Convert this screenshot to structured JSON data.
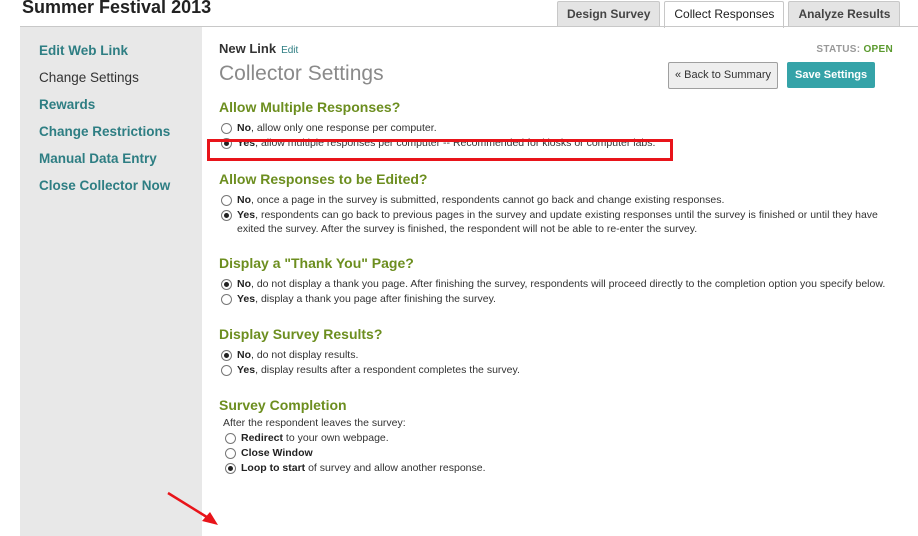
{
  "header": {
    "title": "Summer Festival 2013"
  },
  "tabs": [
    {
      "label": "Design Survey",
      "active": false
    },
    {
      "label": "Collect Responses",
      "active": true
    },
    {
      "label": "Analyze Results",
      "active": false
    }
  ],
  "sidebar": {
    "items": [
      {
        "label": "Edit Web Link",
        "current": false
      },
      {
        "label": "Change Settings",
        "current": true
      },
      {
        "label": "Rewards",
        "current": false
      },
      {
        "label": "Change Restrictions",
        "current": false
      },
      {
        "label": "Manual Data Entry",
        "current": false
      },
      {
        "label": "Close Collector Now",
        "current": false
      }
    ]
  },
  "collector": {
    "name": "New Link",
    "edit_label": "Edit",
    "status_label": "STATUS:",
    "status_value": "OPEN",
    "settings_title": "Collector Settings",
    "back_label": "« Back to Summary",
    "save_label": "Save Settings"
  },
  "sections": {
    "multiple": {
      "title": "Allow Multiple Responses?",
      "no_bold": "No",
      "no_rest": ", allow only one response per computer.",
      "yes_bold": "Yes",
      "yes_rest": ", allow multiple responses per computer -- Recommended for kiosks or computer labs.",
      "selected": "yes"
    },
    "edited": {
      "title": "Allow Responses to be Edited?",
      "no_bold": "No",
      "no_rest": ", once a page in the survey is submitted, respondents cannot go back and change existing responses.",
      "yes_bold": "Yes",
      "yes_rest": ", respondents can go back to previous pages in the survey and update existing responses until the survey is finished or until they have exited the survey. After the survey is finished, the respondent will not be able to re-enter the survey.",
      "selected": "yes"
    },
    "thankyou": {
      "title": "Display a \"Thank You\" Page?",
      "no_bold": "No",
      "no_rest": ", do not display a thank you page. After finishing the survey, respondents will proceed directly to the completion option you specify below.",
      "yes_bold": "Yes",
      "yes_rest": ", display a thank you page after finishing the survey.",
      "selected": "no"
    },
    "results": {
      "title": "Display Survey Results?",
      "no_bold": "No",
      "no_rest": ", do not display results.",
      "yes_bold": "Yes",
      "yes_rest": ", display results after a respondent completes the survey.",
      "selected": "no"
    },
    "completion": {
      "title": "Survey Completion",
      "intro": "After the respondent leaves the survey:",
      "redirect_bold": "Redirect",
      "redirect_rest": " to your own webpage.",
      "close_bold": "Close Window",
      "loop_bold": "Loop to start",
      "loop_rest": " of survey and allow another response.",
      "selected": "loop"
    }
  },
  "colors": {
    "accent": "#2e7e83",
    "section_title": "#6c8e1f",
    "save_button": "#35a3a8",
    "annotation": "#e8141a"
  }
}
